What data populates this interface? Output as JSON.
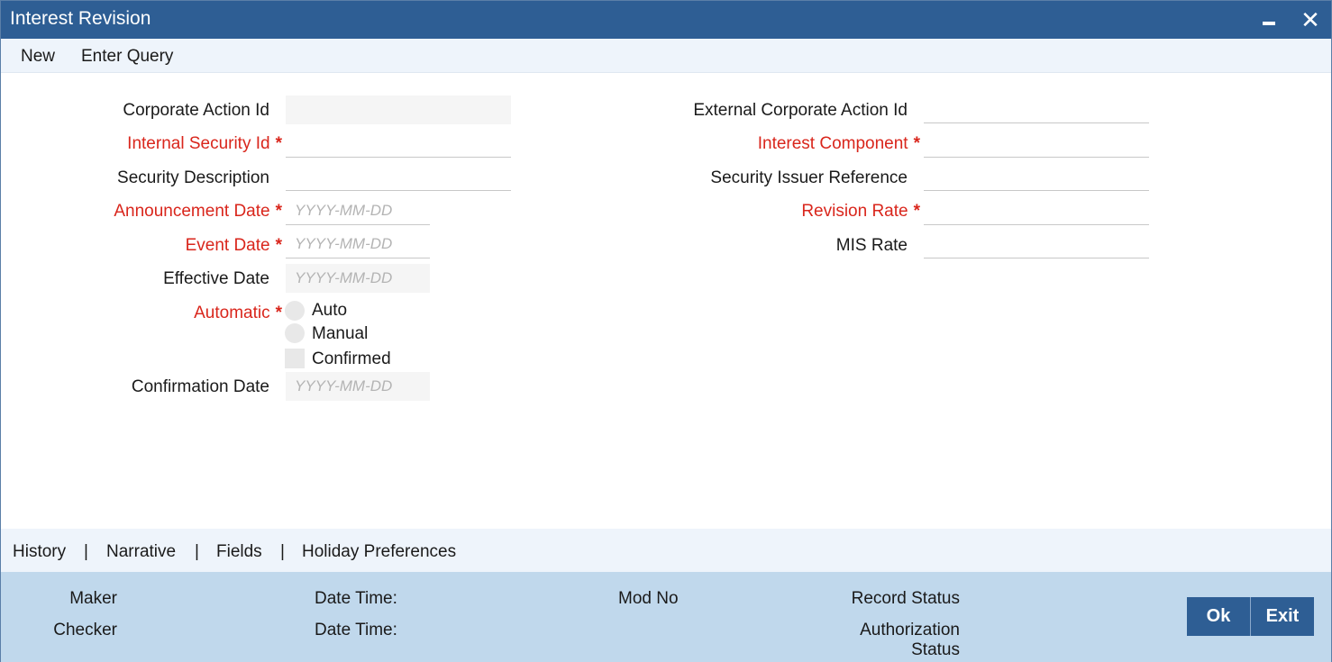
{
  "window": {
    "title": "Interest Revision",
    "minimize_icon": "minimize-icon",
    "close_icon": "close-icon",
    "close_glyph": "✕"
  },
  "toolbar": {
    "new_label": "New",
    "enter_query_label": "Enter Query"
  },
  "form": {
    "corporate_action_id": {
      "label": "Corporate Action Id",
      "value": ""
    },
    "internal_security_id": {
      "label": "Internal Security Id",
      "required": "*",
      "value": ""
    },
    "security_description": {
      "label": "Security Description",
      "value": ""
    },
    "announcement_date": {
      "label": "Announcement Date",
      "required": "*",
      "placeholder": "YYYY-MM-DD"
    },
    "event_date": {
      "label": "Event Date",
      "required": "*",
      "placeholder": "YYYY-MM-DD"
    },
    "effective_date": {
      "label": "Effective Date",
      "placeholder": "YYYY-MM-DD"
    },
    "automatic": {
      "label": "Automatic",
      "required": "*",
      "options": [
        "Auto",
        "Manual"
      ],
      "confirmed_label": "Confirmed"
    },
    "confirmation_date": {
      "label": "Confirmation Date",
      "placeholder": "YYYY-MM-DD"
    },
    "external_corporate_action_id": {
      "label": "External Corporate Action Id",
      "value": ""
    },
    "interest_component": {
      "label": "Interest Component",
      "required": "*",
      "value": ""
    },
    "security_issuer_reference": {
      "label": "Security Issuer Reference",
      "value": ""
    },
    "revision_rate": {
      "label": "Revision Rate",
      "required": "*",
      "value": ""
    },
    "mis_rate": {
      "label": "MIS Rate",
      "value": ""
    }
  },
  "subnav": {
    "items": [
      "History",
      "Narrative",
      "Fields",
      "Holiday Preferences"
    ],
    "separator": "|"
  },
  "footer": {
    "maker_label": "Maker",
    "checker_label": "Checker",
    "date_time_label": "Date Time:",
    "mod_no_label": "Mod No",
    "record_status_label": "Record Status",
    "authorization_status_label_1": "Authorization",
    "authorization_status_label_2": "Status",
    "ok_label": "Ok",
    "exit_label": "Exit"
  },
  "colors": {
    "titlebar": "#2e5e94",
    "toolbar_bg": "#eef4fb",
    "footer_bg": "#c0d8ec",
    "required_text": "#d9261c"
  }
}
